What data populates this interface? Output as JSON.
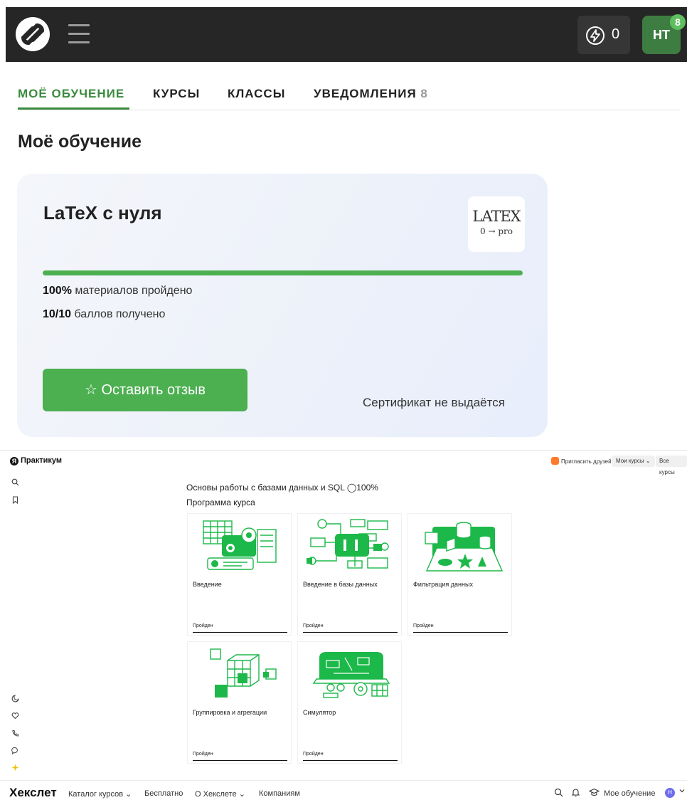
{
  "topbar": {
    "energy_value": "0",
    "avatar_initials": "HT",
    "avatar_badge": "8",
    "colors": {
      "bar": "#262626",
      "accent": "#3a8b3f"
    }
  },
  "tabs": [
    {
      "label": "МОЁ ОБУЧЕНИЕ",
      "active": true
    },
    {
      "label": "КУРСЫ"
    },
    {
      "label": "КЛАССЫ"
    },
    {
      "label": "УВЕДОМЛЕНИЯ",
      "count": "8"
    }
  ],
  "page_title": "Моё обучение",
  "course": {
    "title": "LaTeX с нуля",
    "logo_line1": "LATEX",
    "logo_line2": "0 → pro",
    "progress_fraction": 1.0,
    "materials_value": "100%",
    "materials_text": " материалов пройдено",
    "points_value": "10/10",
    "points_text": " баллов получено",
    "review_button": "☆ Оставить отзыв",
    "certificate_note": "Сертификат не выдаётся"
  },
  "practicum": {
    "brand": "Практикум",
    "brand_icon": "Я",
    "invite": "Пригласить друзей",
    "my_courses": "Мои курсы ⌄",
    "all_courses": "Все курсы",
    "course_title": "Основы работы с базами данных и SQL ◯100%",
    "program_label": "Программа курса",
    "modules": [
      {
        "title": "Введение",
        "status": "Пройден",
        "icon": "illustration-intro"
      },
      {
        "title": "Введение в базы данных",
        "status": "Пройден",
        "icon": "illustration-databases"
      },
      {
        "title": "Фильтрация данных",
        "status": "Пройден",
        "icon": "illustration-filtering"
      },
      {
        "title": "Группировка и агрегации",
        "status": "Пройден",
        "icon": "illustration-cubes"
      },
      {
        "title": "Симулятор",
        "status": "Пройден",
        "icon": "illustration-simulator"
      }
    ],
    "illustration_color": "#1db84a"
  },
  "hexlet": {
    "logo": "Хекслет",
    "nav": [
      "Каталог курсов ⌄",
      "Бесплатно",
      "О Хекслете ⌄",
      "Компаниям"
    ],
    "my_learning": "Мое обучение",
    "avatar": "Н"
  }
}
